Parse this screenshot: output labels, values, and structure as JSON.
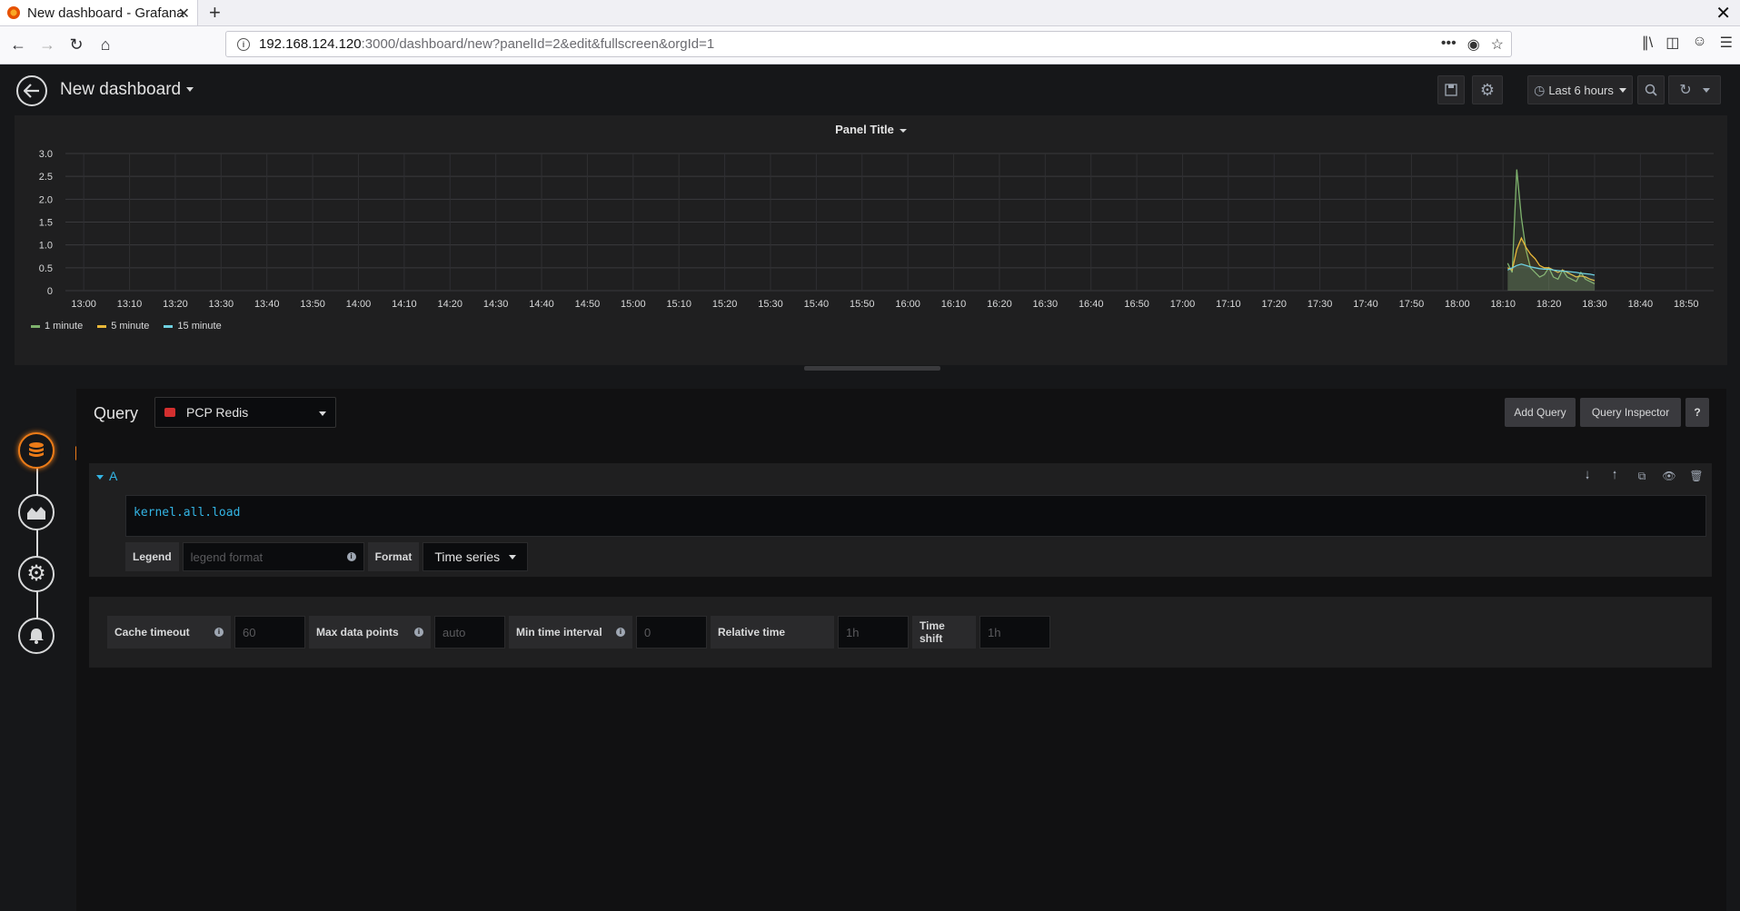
{
  "browser": {
    "tab_title": "New dashboard - Grafana",
    "url_host": "192.168.124.120",
    "url_rest": ":3000/dashboard/new?panelId=2&edit&fullscreen&orgId=1"
  },
  "dashboard": {
    "title": "New dashboard",
    "time_range": "Last 6 hours"
  },
  "panel": {
    "title": "Panel Title",
    "legend": [
      {
        "name": "1 minute",
        "color": "#7eb26d"
      },
      {
        "name": "5 minute",
        "color": "#eab839"
      },
      {
        "name": "15 minute",
        "color": "#6ed0e0"
      }
    ]
  },
  "chart_data": {
    "type": "line",
    "title": "Panel Title",
    "xlabel": "",
    "ylabel": "",
    "ylim": [
      0,
      3.0
    ],
    "y_ticks": [
      "0",
      "0.5",
      "1.0",
      "1.5",
      "2.0",
      "2.5",
      "3.0"
    ],
    "x_ticks": [
      "13:00",
      "13:10",
      "13:20",
      "13:30",
      "13:40",
      "13:50",
      "14:00",
      "14:10",
      "14:20",
      "14:30",
      "14:40",
      "14:50",
      "15:00",
      "15:10",
      "15:20",
      "15:30",
      "15:40",
      "15:50",
      "16:00",
      "16:10",
      "16:20",
      "16:30",
      "16:40",
      "16:50",
      "17:00",
      "17:10",
      "17:20",
      "17:30",
      "17:40",
      "17:50",
      "18:00",
      "18:10",
      "18:20",
      "18:30",
      "18:40",
      "18:50"
    ],
    "x_units": "minutes since 13:00",
    "series": [
      {
        "name": "1 minute",
        "color": "#7eb26d",
        "x": [
          311,
          312,
          313,
          314,
          315,
          316,
          317,
          318,
          319,
          320,
          321,
          322,
          323,
          324,
          325,
          326,
          327,
          328,
          329,
          330
        ],
        "values": [
          0.6,
          0.4,
          2.65,
          1.6,
          0.9,
          0.5,
          0.4,
          0.3,
          0.35,
          0.5,
          0.3,
          0.25,
          0.45,
          0.3,
          0.25,
          0.2,
          0.4,
          0.25,
          0.2,
          0.15
        ]
      },
      {
        "name": "5 minute",
        "color": "#eab839",
        "x": [
          311,
          312,
          313,
          314,
          315,
          316,
          317,
          318,
          319,
          320,
          321,
          322,
          323,
          324,
          325,
          326,
          327,
          328,
          329,
          330
        ],
        "values": [
          0.5,
          0.45,
          0.9,
          1.15,
          0.95,
          0.8,
          0.7,
          0.55,
          0.5,
          0.5,
          0.45,
          0.4,
          0.45,
          0.4,
          0.35,
          0.3,
          0.32,
          0.3,
          0.25,
          0.22
        ]
      },
      {
        "name": "15 minute",
        "color": "#6ed0e0",
        "x": [
          311,
          312,
          313,
          314,
          315,
          316,
          317,
          318,
          319,
          320,
          321,
          322,
          323,
          324,
          325,
          326,
          327,
          328,
          329,
          330
        ],
        "values": [
          0.45,
          0.5,
          0.55,
          0.58,
          0.55,
          0.52,
          0.5,
          0.48,
          0.47,
          0.47,
          0.45,
          0.44,
          0.43,
          0.42,
          0.41,
          0.4,
          0.38,
          0.37,
          0.36,
          0.34
        ]
      }
    ]
  },
  "editor": {
    "query_label": "Query",
    "datasource": "PCP Redis",
    "add_query": "Add Query",
    "query_inspector": "Query Inspector",
    "help": "?",
    "row_letter": "A",
    "query_text": "kernel.all.load",
    "legend_label": "Legend",
    "legend_placeholder": "legend format",
    "format_label": "Format",
    "format_value": "Time series"
  },
  "options": {
    "cache_timeout_label": "Cache timeout",
    "cache_timeout_placeholder": "60",
    "max_data_points_label": "Max data points",
    "max_data_points_placeholder": "auto",
    "min_interval_label": "Min time interval",
    "min_interval_placeholder": "0",
    "relative_time_label": "Relative time",
    "relative_time_placeholder": "1h",
    "time_shift_label": "Time shift",
    "time_shift_placeholder": "1h"
  }
}
